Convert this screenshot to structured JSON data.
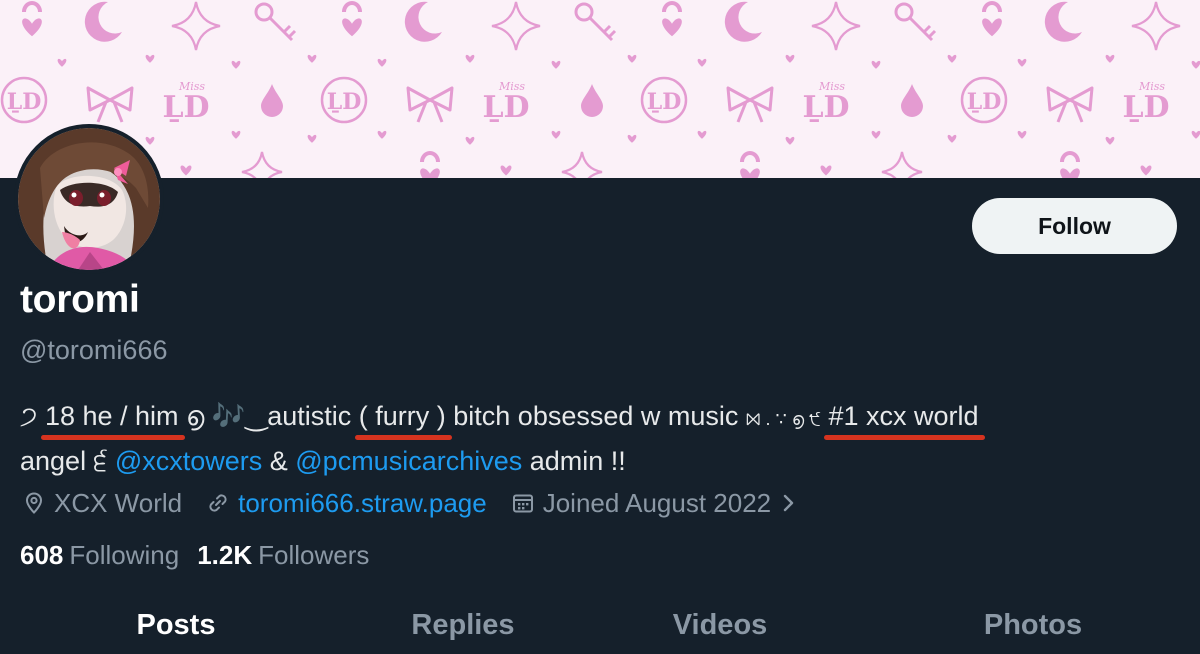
{
  "profile": {
    "display_name": "toromi",
    "handle": "@toromi666",
    "follow_label": "Follow"
  },
  "bio": {
    "line1": {
      "lead": "੭",
      "pronouns": "18 he / him",
      "after_pronouns": " ൭ 🎶‿",
      "autistic": "autistic",
      "furry": "( furry )",
      "after_furry": " bitch obsessed w music ",
      "deco": "⨝ . ∵ ൭ ੯",
      "xcx": "#1 xcx world"
    },
    "line2": {
      "lead": "angel ੬ ",
      "mention1": "@xcxtowers",
      "amp": " & ",
      "mention2": "@pcmusicarchives",
      "tail": " admin !!"
    }
  },
  "meta": {
    "location": "XCX World",
    "website": "toromi666.straw.page",
    "joined": "Joined August 2022"
  },
  "stats": {
    "following_count": "608",
    "following_label": "Following",
    "followers_count": "1.2K",
    "followers_label": "Followers"
  },
  "tabs": [
    "Posts",
    "Replies",
    "Videos",
    "Photos"
  ],
  "active_tab": "Posts",
  "banner": {
    "monogram": "ḺD",
    "script": "Miss"
  },
  "colors": {
    "background": "#15202b",
    "link": "#1d9bf0",
    "muted": "#8b98a5",
    "banner_pink": "#e49bd1",
    "underline": "#d6331f"
  }
}
